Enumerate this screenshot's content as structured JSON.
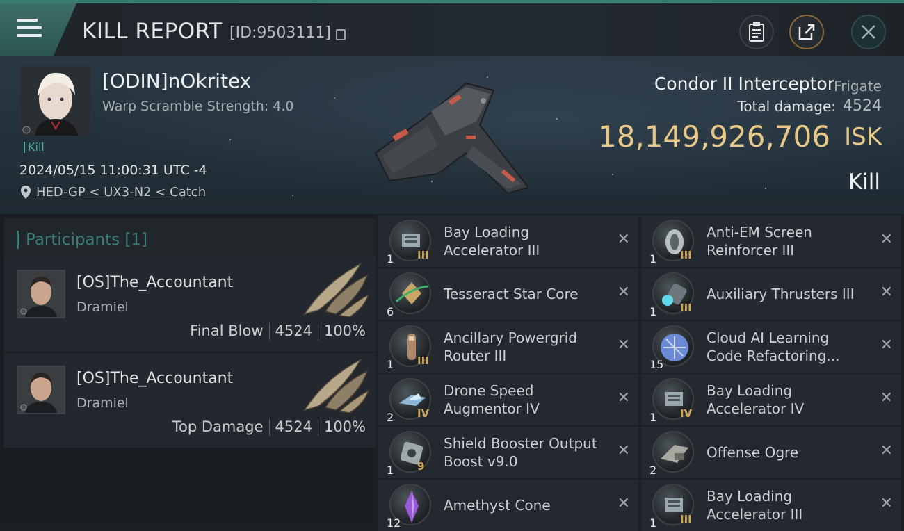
{
  "header": {
    "title": "KILL REPORT",
    "report_id": "[ID:9503111]"
  },
  "victim": {
    "name": "[ODIN]nOkritex",
    "warp_scramble": "Warp Scramble Strength: 4.0",
    "tag": "Kill",
    "timestamp": "2024/05/15 11:00:31 UTC -4",
    "location": "HED-GP < UX3-N2 < Catch"
  },
  "ship": {
    "name": "Condor II Interceptor",
    "class": "Frigate",
    "total_damage_label": "Total damage:",
    "total_damage": "4524",
    "isk_value": "18,149,926,706",
    "isk_unit": "ISK",
    "result": "Kill"
  },
  "participants": {
    "title": "Participants",
    "count": "[1]",
    "rows": [
      {
        "name": "[OS]The_Accountant",
        "ship": "Dramiel",
        "role": "Final Blow",
        "damage": "4524",
        "percent": "100%"
      },
      {
        "name": "[OS]The_Accountant",
        "ship": "Dramiel",
        "role": "Top Damage",
        "damage": "4524",
        "percent": "100%"
      }
    ]
  },
  "items": [
    {
      "name": "Bay Loading Accelerator III",
      "qty": "1",
      "tier": "III",
      "icon": "bay-loader-icon",
      "color": "#9aa8b0"
    },
    {
      "name": "Anti-EM Screen Reinforcer III",
      "qty": "1",
      "tier": "III",
      "icon": "shield-reinforcer-icon",
      "color": "#b8c0c4"
    },
    {
      "name": "Tesseract Star Core",
      "qty": "6",
      "tier": "",
      "icon": "star-core-icon",
      "color": "#c9a56a"
    },
    {
      "name": "Auxiliary Thrusters III",
      "qty": "1",
      "tier": "III",
      "icon": "thruster-icon",
      "color": "#5fd8e8"
    },
    {
      "name": "Ancillary Powergrid Router III",
      "qty": "1",
      "tier": "III",
      "icon": "powergrid-router-icon",
      "color": "#b08a6a"
    },
    {
      "name": "Cloud AI Learning Code Refactoring...",
      "qty": "15",
      "tier": "",
      "icon": "cloud-ai-icon",
      "color": "#6a8ad8"
    },
    {
      "name": "Drone Speed Augmentor IV",
      "qty": "2",
      "tier": "IV",
      "icon": "drone-augmentor-icon",
      "color": "#8fb8d8"
    },
    {
      "name": "Bay Loading Accelerator IV",
      "qty": "1",
      "tier": "IV",
      "icon": "bay-loader-icon",
      "color": "#9aa8b0"
    },
    {
      "name": "Shield Booster Output Boost v9.0",
      "qty": "1",
      "tier": "9",
      "icon": "shield-booster-icon",
      "color": "#a0a8ac"
    },
    {
      "name": "Offense Ogre",
      "qty": "2",
      "tier": "",
      "icon": "ogre-drone-icon",
      "color": "#a8a8a0"
    },
    {
      "name": "Amethyst Cone",
      "qty": "12",
      "tier": "",
      "icon": "amethyst-icon",
      "color": "#9a5ad8"
    },
    {
      "name": "Bay Loading Accelerator III",
      "qty": "1",
      "tier": "III",
      "icon": "bay-loader-icon",
      "color": "#9aa8b0"
    }
  ]
}
